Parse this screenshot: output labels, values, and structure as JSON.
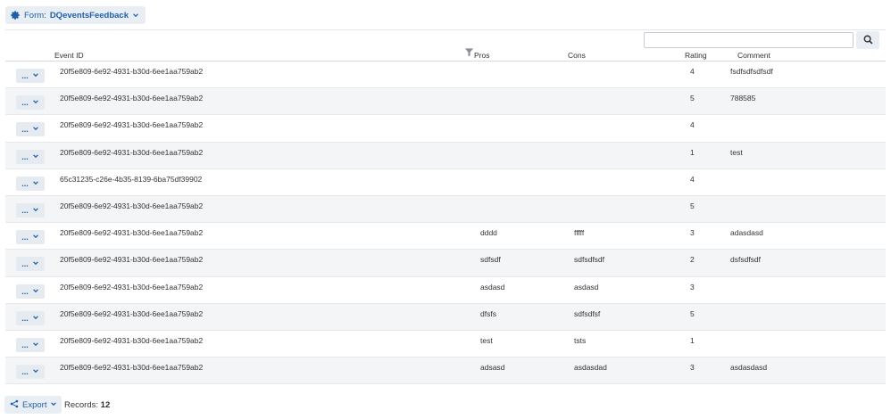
{
  "form": {
    "prefix": "Form:",
    "name": "DQeventsFeedback"
  },
  "search": {
    "placeholder": ""
  },
  "columns": {
    "event_id": "Event ID",
    "pros": "Pros",
    "cons": "Cons",
    "rating": "Rating",
    "comment": "Comment"
  },
  "row_action_label": "...",
  "rows": [
    {
      "event_id": "20f5e809-6e92-4931-b30d-6ee1aa759ab2",
      "pros": "",
      "cons": "",
      "rating": "4",
      "comment": "fsdfsdfsdfsdf"
    },
    {
      "event_id": "20f5e809-6e92-4931-b30d-6ee1aa759ab2",
      "pros": "",
      "cons": "",
      "rating": "5",
      "comment": "788585"
    },
    {
      "event_id": "20f5e809-6e92-4931-b30d-6ee1aa759ab2",
      "pros": "",
      "cons": "",
      "rating": "4",
      "comment": ""
    },
    {
      "event_id": "20f5e809-6e92-4931-b30d-6ee1aa759ab2",
      "pros": "",
      "cons": "",
      "rating": "1",
      "comment": "test"
    },
    {
      "event_id": "65c31235-c26e-4b35-8139-6ba75df39902",
      "pros": "",
      "cons": "",
      "rating": "4",
      "comment": ""
    },
    {
      "event_id": "20f5e809-6e92-4931-b30d-6ee1aa759ab2",
      "pros": "",
      "cons": "",
      "rating": "5",
      "comment": ""
    },
    {
      "event_id": "20f5e809-6e92-4931-b30d-6ee1aa759ab2",
      "pros": "dddd",
      "cons": "fffff",
      "rating": "3",
      "comment": "adasdasd"
    },
    {
      "event_id": "20f5e809-6e92-4931-b30d-6ee1aa759ab2",
      "pros": "sdfsdf",
      "cons": "sdfsdfsdf",
      "rating": "2",
      "comment": "dsfsdfsdf"
    },
    {
      "event_id": "20f5e809-6e92-4931-b30d-6ee1aa759ab2",
      "pros": "asdasd",
      "cons": "asdasd",
      "rating": "3",
      "comment": ""
    },
    {
      "event_id": "20f5e809-6e92-4931-b30d-6ee1aa759ab2",
      "pros": "dfsfs",
      "cons": "sdfsdfsf",
      "rating": "5",
      "comment": ""
    },
    {
      "event_id": "20f5e809-6e92-4931-b30d-6ee1aa759ab2",
      "pros": "test",
      "cons": "tsts",
      "rating": "1",
      "comment": ""
    },
    {
      "event_id": "20f5e809-6e92-4931-b30d-6ee1aa759ab2",
      "pros": "adsasd",
      "cons": "asdasdad",
      "rating": "3",
      "comment": "asdasdasd"
    }
  ],
  "footer": {
    "export_label": "Export",
    "records_label": "Records:",
    "records_count": "12"
  },
  "icons": {
    "form": "gear-icon",
    "search": "search-icon",
    "filter": "filter-icon",
    "export": "share-icon",
    "dropdown": "chevron-down-icon"
  },
  "colors": {
    "accent": "#1f5fa8",
    "button_bg": "#e9eef5",
    "row_alt": "#f4f5f7"
  }
}
